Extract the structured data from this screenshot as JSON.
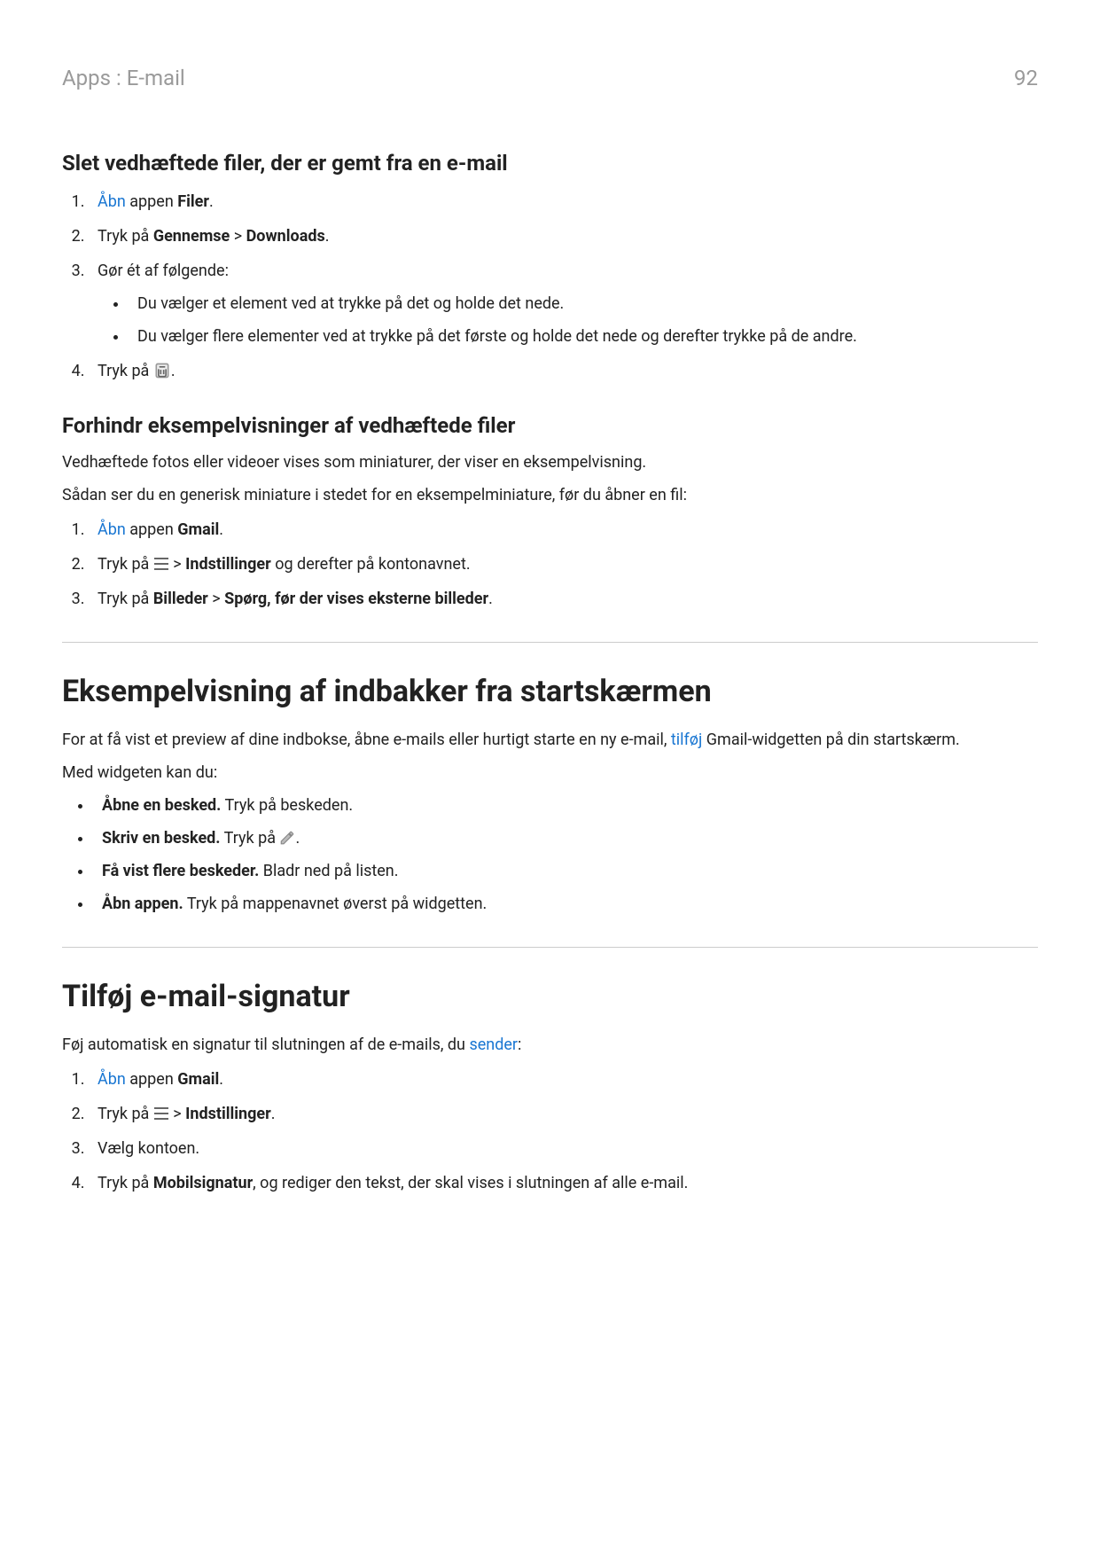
{
  "header": {
    "breadcrumb": "Apps : E-mail",
    "page_number": "92"
  },
  "section1": {
    "title": "Slet vedhæftede filer, der er gemt fra en e-mail",
    "step1": {
      "open_link": "Åbn",
      "text": " appen ",
      "bold": "Filer",
      "period": "."
    },
    "step2": {
      "prefix": "Tryk på ",
      "bold1": "Gennemse",
      "gt": " > ",
      "bold2": "Downloads",
      "period": "."
    },
    "step3": {
      "text": "Gør ét af følgende:",
      "bullet1": "Du vælger et element ved at trykke på det og holde det nede.",
      "bullet2": "Du vælger flere elementer ved at trykke på det første og holde det nede og derefter trykke på de andre."
    },
    "step4": {
      "prefix": "Tryk på ",
      "period": "."
    }
  },
  "section2": {
    "title": "Forhindr eksempelvisninger af vedhæftede filer",
    "p1": "Vedhæftede fotos eller videoer vises som miniaturer, der viser en eksempelvisning.",
    "p2": "Sådan ser du en generisk miniature i stedet for en eksempelminiature, før du åbner en fil:",
    "step1": {
      "open_link": "Åbn",
      "text": " appen ",
      "bold": "Gmail",
      "period": "."
    },
    "step2": {
      "prefix": "Tryk på ",
      "gt": " > ",
      "bold": "Indstillinger",
      "suffix": " og derefter på kontonavnet."
    },
    "step3": {
      "prefix": "Tryk på ",
      "bold1": "Billeder",
      "gt": " > ",
      "bold2": "Spørg, før der vises eksterne billeder",
      "period": "."
    }
  },
  "section3": {
    "title": "Eksempelvisning af indbakker fra startskærmen",
    "p1_prefix": "For at få vist et preview af dine indbokse, åbne e-mails eller hurtigt starte en ny e-mail, ",
    "p1_link": "tilføj",
    "p1_suffix": " Gmail-widgetten på din startskærm.",
    "p2": "Med widgeten kan du:",
    "b1_bold": "Åbne en besked.",
    "b1_text": " Tryk på beskeden.",
    "b2_bold": "Skriv en besked.",
    "b2_prefix": " Tryk på ",
    "b2_period": ".",
    "b3_bold": "Få vist flere beskeder.",
    "b3_text": " Bladr ned på listen.",
    "b4_bold": "Åbn appen.",
    "b4_text": " Tryk på mappenavnet øverst på widgetten."
  },
  "section4": {
    "title": "Tilføj e-mail-signatur",
    "p1_prefix": "Føj automatisk en signatur til slutningen af de e-mails, du ",
    "p1_link": "sender",
    "p1_suffix": ":",
    "step1": {
      "open_link": "Åbn",
      "text": " appen ",
      "bold": "Gmail",
      "period": "."
    },
    "step2": {
      "prefix": "Tryk på ",
      "gt": " > ",
      "bold": "Indstillinger",
      "period": "."
    },
    "step3": "Vælg kontoen.",
    "step4": {
      "prefix": "Tryk på ",
      "bold": "Mobilsignatur",
      "suffix": ", og rediger den tekst, der skal vises i slutningen af alle e-mail."
    }
  }
}
